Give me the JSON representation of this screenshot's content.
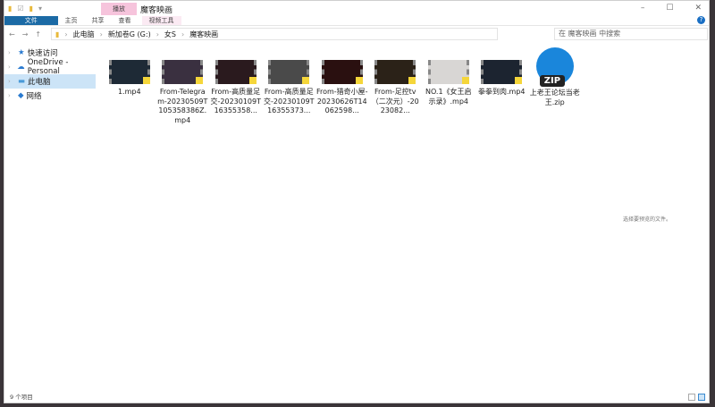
{
  "window": {
    "title": "魔客映画",
    "context_tab": "播放"
  },
  "ribbon": {
    "tabs": [
      "文件",
      "主页",
      "共享",
      "查看",
      "视频工具"
    ]
  },
  "address": {
    "crumbs": [
      "此电脑",
      "新加卷G (G:)",
      "女S",
      "魔客映画"
    ],
    "search_placeholder": "在 魔客映画 中搜索"
  },
  "sidebar": {
    "items": [
      {
        "label": "快速访问"
      },
      {
        "label": "OneDrive - Personal"
      },
      {
        "label": "此电脑"
      },
      {
        "label": "网络"
      }
    ]
  },
  "files": [
    {
      "name": "1.mp4",
      "type": "video",
      "color": "#1e2a36"
    },
    {
      "name": "From-Telegram-20230509T105358386Z.mp4",
      "type": "video",
      "color": "#3a3040"
    },
    {
      "name": "From-高质量足交-20230109T16355358...",
      "type": "video",
      "color": "#2a1a1e"
    },
    {
      "name": "From-高质量足交-20230109T16355373...",
      "type": "video",
      "color": "#4a4a4a"
    },
    {
      "name": "From-猎奇小屋-20230626T14062598...",
      "type": "video",
      "color": "#2a1010"
    },
    {
      "name": "From-足控tv（二次元）-2023082...",
      "type": "video",
      "color": "#2b2218"
    },
    {
      "name": "NO.1《女王启示录》.mp4",
      "type": "video",
      "color": "#d8d6d4"
    },
    {
      "name": "拳拳到肉.mp4",
      "type": "video",
      "color": "#1c2430"
    },
    {
      "name": "上老王论坛当老王.zip",
      "type": "zip",
      "label": "ZIP"
    }
  ],
  "preview_text": "选择要预览的文件。",
  "status": {
    "count": "9 个项目"
  }
}
